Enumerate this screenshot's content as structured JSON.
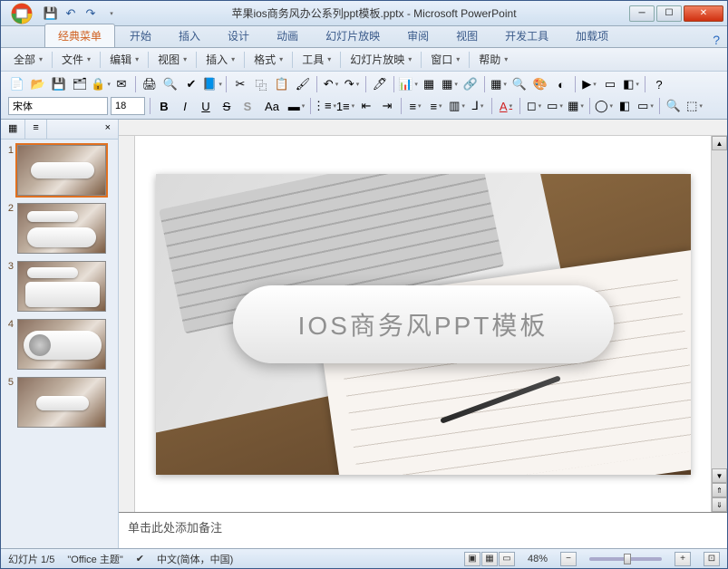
{
  "titlebar": {
    "filename": "苹果ios商务风办公系列ppt模板.pptx - Microsoft PowerPoint",
    "qat": {
      "save": "💾",
      "undo": "↶",
      "redo": "↷"
    },
    "win": {
      "min": "─",
      "max": "☐",
      "close": "✕"
    }
  },
  "ribbon_tabs": [
    "经典菜单",
    "开始",
    "插入",
    "设计",
    "动画",
    "幻灯片放映",
    "审阅",
    "视图",
    "开发工具",
    "加载项"
  ],
  "active_tab": 0,
  "menubar": [
    "全部",
    "文件",
    "编辑",
    "视图",
    "插入",
    "格式",
    "工具",
    "幻灯片放映",
    "窗口",
    "帮助"
  ],
  "outline_tabs": {
    "slides": "▦",
    "outline": "≡",
    "close": "×"
  },
  "slides": [
    1,
    2,
    3,
    4,
    5
  ],
  "selected_slide": 1,
  "main_slide_text": "IOS商务风PPT模板",
  "notes_placeholder": "单击此处添加备注",
  "status": {
    "slide_counter": "幻灯片 1/5",
    "theme": "\"Office 主题\"",
    "lang": "中文(简体，中国)",
    "zoom": "48%"
  },
  "font": {
    "family": "宋体",
    "size": "18"
  },
  "icons": {
    "help": "?",
    "new": "📄",
    "open": "📂",
    "save": "💾",
    "saveall": "🗂",
    "print": "🖨",
    "preview": "🔍",
    "spell": "✔",
    "cut": "✂",
    "copy": "⿻",
    "paste": "📋",
    "format": "🖌",
    "undo": "↶",
    "redo": "↷",
    "table": "▦",
    "chart": "📊",
    "link": "🔗",
    "bold": "B",
    "italic": "I",
    "underline": "U",
    "strike": "S",
    "shadow": "S",
    "upsize": "Aa",
    "color": "A",
    "alignl": "≡",
    "alignc": "≡",
    "alignr": "≡",
    "bullets": "⋮≡",
    "number": "1≡",
    "indent-": "⇤",
    "indent+": "⇥",
    "check": "✔",
    "plus": "+",
    "minus": "−",
    "fit": "⊡"
  }
}
